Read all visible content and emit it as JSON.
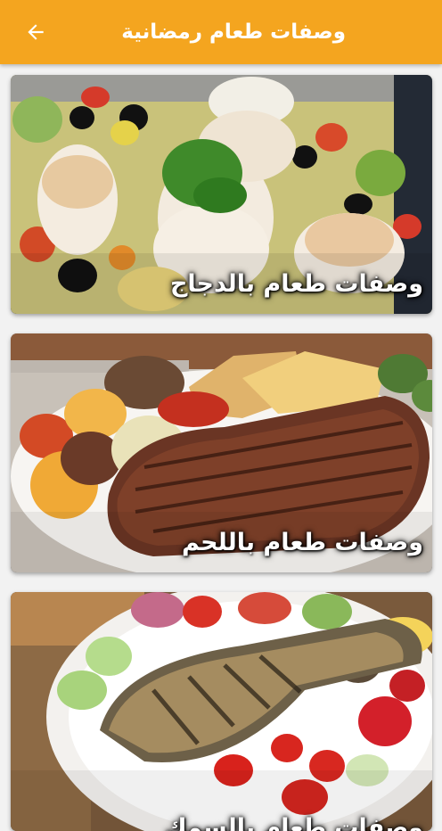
{
  "appbar": {
    "title": "وصفات طعام رمضانية",
    "back_icon": "arrow-left-icon",
    "background_color": "#f4a51f"
  },
  "cards": [
    {
      "label": "وصفات طعام بالدجاج",
      "image": "chicken-dish-photo"
    },
    {
      "label": "وصفات طعام باللحم",
      "image": "steak-dish-photo"
    },
    {
      "label": "وصفات طعام بالسمك",
      "image": "grilled-fish-photo"
    }
  ]
}
